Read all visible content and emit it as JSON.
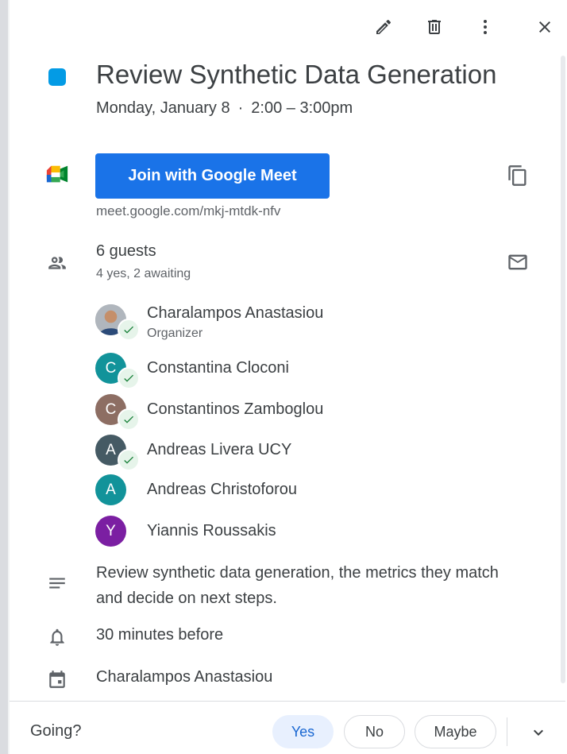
{
  "event": {
    "title": "Review Synthetic Data Generation",
    "date": "Monday, January 8",
    "separator": "·",
    "time": "2:00 – 3:00pm",
    "color": "#039be5"
  },
  "meet": {
    "join_label": "Join with Google Meet",
    "link": "meet.google.com/mkj-mtdk-nfv"
  },
  "guests": {
    "count_label": "6 guests",
    "summary": "4 yes, 2 awaiting",
    "list": [
      {
        "name": "Charalampos Anastasiou",
        "role": "Organizer",
        "initial": "",
        "color": "#8a8f98",
        "accepted": true
      },
      {
        "name": "Constantina Cloconi",
        "role": "",
        "initial": "C",
        "color": "#12939a",
        "accepted": true
      },
      {
        "name": "Constantinos Zamboglou",
        "role": "",
        "initial": "C",
        "color": "#8d6e63",
        "accepted": true
      },
      {
        "name": "Andreas Livera UCY",
        "role": "",
        "initial": "A",
        "color": "#455a64",
        "accepted": true
      },
      {
        "name": "Andreas Christoforou",
        "role": "",
        "initial": "A",
        "color": "#12939a",
        "accepted": false
      },
      {
        "name": "Yiannis Roussakis",
        "role": "",
        "initial": "Y",
        "color": "#7b1fa2",
        "accepted": false
      }
    ]
  },
  "description": "Review synthetic data generation, the metrics they match and decide on next steps.",
  "reminder": "30 minutes before",
  "calendar_owner": "Charalampos Anastasiou",
  "rsvp": {
    "question": "Going?",
    "yes": "Yes",
    "no": "No",
    "maybe": "Maybe",
    "selected": "Yes"
  },
  "icons": {
    "edit": "pencil-icon",
    "delete": "trash-icon",
    "more": "more-vert-icon",
    "close": "close-icon",
    "copy": "copy-icon",
    "email": "mail-icon",
    "guests": "people-icon",
    "description": "notes-icon",
    "reminder": "bell-icon",
    "calendar": "calendar-icon",
    "expand": "chevron-down-icon"
  }
}
